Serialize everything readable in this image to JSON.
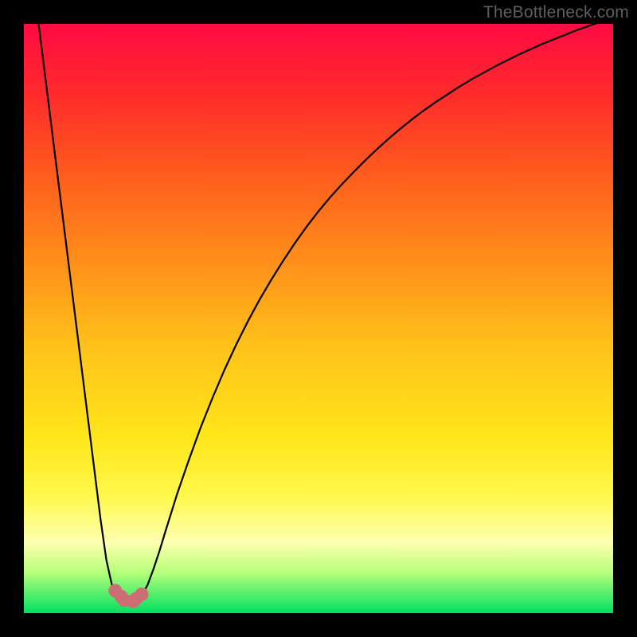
{
  "watermark": "TheBottleneck.com",
  "colors": {
    "frame": "#000000",
    "curve": "#000000",
    "marker_fill": "#cc6e73",
    "gradient_stops": [
      "#ff0a42",
      "#ff2b2b",
      "#ff5a1e",
      "#ff8e1a",
      "#ffc21a",
      "#ffe61a",
      "#fff84a",
      "#fdffb0",
      "#b8ff7a",
      "#00e060"
    ]
  },
  "chart_data": {
    "type": "line",
    "title": "",
    "xlabel": "",
    "ylabel": "",
    "xlim": [
      0,
      100
    ],
    "ylim": [
      0,
      100
    ],
    "x": [
      0,
      1,
      2,
      3,
      4,
      5,
      6,
      7,
      8,
      9,
      10,
      11,
      12,
      13,
      14,
      15,
      16,
      17,
      18,
      19,
      20,
      21,
      22,
      23,
      24,
      25,
      26,
      28,
      30,
      32,
      34,
      36,
      38,
      40,
      42,
      44,
      46,
      48,
      50,
      52,
      54,
      56,
      58,
      60,
      62,
      64,
      66,
      68,
      70,
      72,
      74,
      76,
      78,
      80,
      82,
      84,
      86,
      88,
      90,
      92,
      94,
      96,
      98,
      100
    ],
    "y": [
      120,
      112,
      104,
      96,
      88,
      80,
      72,
      64,
      56,
      48,
      40,
      32,
      24,
      16,
      9,
      4.5,
      2.2,
      2.0,
      2.0,
      2.2,
      3.0,
      4.8,
      7.5,
      10.5,
      13.8,
      17.0,
      20.2,
      26.0,
      31.5,
      36.5,
      41.2,
      45.5,
      49.5,
      53.2,
      56.6,
      59.8,
      62.8,
      65.6,
      68.2,
      70.6,
      72.8,
      74.9,
      76.9,
      78.8,
      80.6,
      82.3,
      83.9,
      85.4,
      86.8,
      88.1,
      89.4,
      90.6,
      91.7,
      92.8,
      93.8,
      94.8,
      95.7,
      96.6,
      97.4,
      98.2,
      99.0,
      99.7,
      100.4,
      101.0
    ],
    "markers": {
      "x": [
        15.5,
        17.0,
        18.5,
        20.0,
        16.5,
        19.0
      ],
      "y": [
        3.8,
        2.2,
        2.0,
        3.2,
        2.8,
        2.4
      ]
    }
  }
}
